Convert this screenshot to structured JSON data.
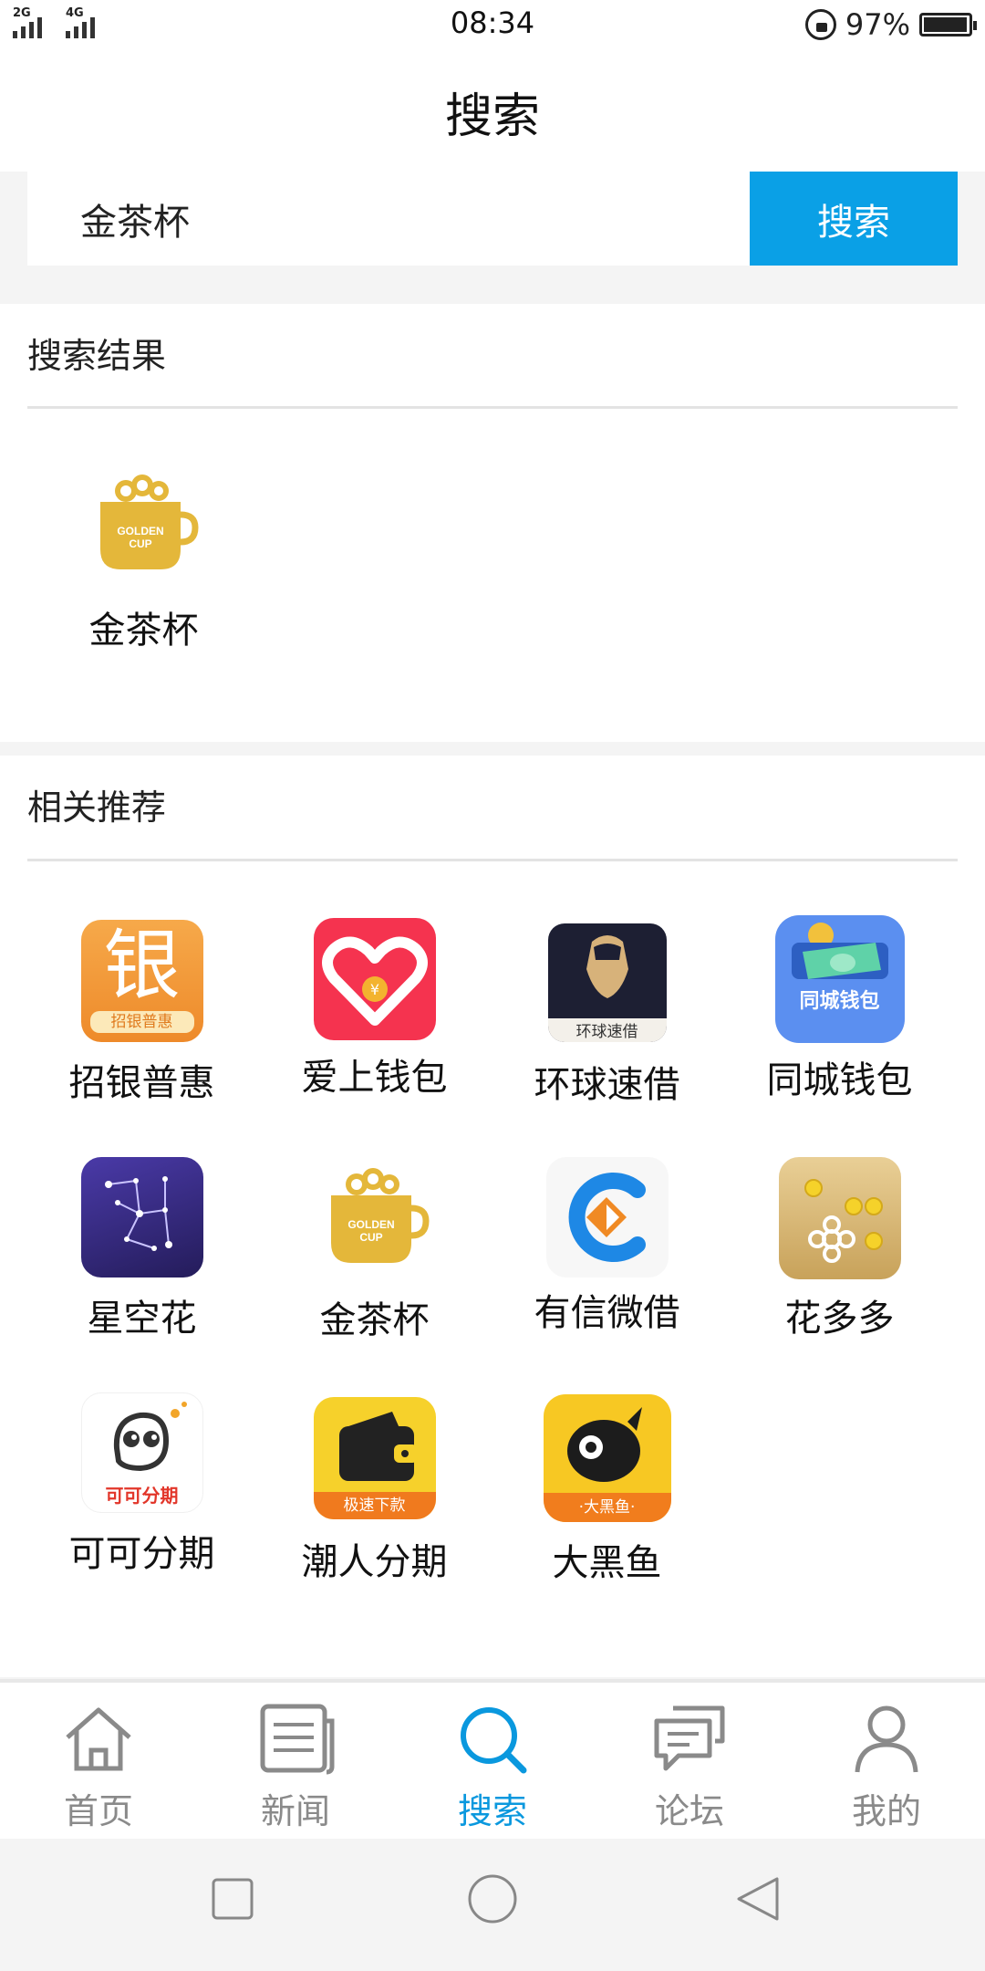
{
  "status_bar": {
    "network_left": "2G",
    "network_right": "4G",
    "time": "08:34",
    "battery": "97%",
    "battery_level": 0.97
  },
  "header": {
    "title": "搜索"
  },
  "search": {
    "value": "金茶杯",
    "button_label": "搜索"
  },
  "results": {
    "title": "搜索结果",
    "items": [
      {
        "label": "金茶杯",
        "icon": "golden-cup-icon"
      }
    ]
  },
  "recommend": {
    "title": "相关推荐",
    "items": [
      {
        "label": "招银普惠",
        "icon": "zhaoyin-puhui-icon",
        "icon_text": "银",
        "icon_sub": "招银普惠"
      },
      {
        "label": "爱上钱包",
        "icon": "heart-wallet-icon"
      },
      {
        "label": "环球速借",
        "icon": "huanqiu-sujie-icon",
        "icon_sub": "环球速借"
      },
      {
        "label": "同城钱包",
        "icon": "tongcheng-wallet-icon",
        "icon_sub": "同城钱包"
      },
      {
        "label": "星空花",
        "icon": "starry-sky-icon"
      },
      {
        "label": "金茶杯",
        "icon": "golden-cup-icon"
      },
      {
        "label": "有信微借",
        "icon": "youxin-weijie-icon"
      },
      {
        "label": "花多多",
        "icon": "huaduoduo-icon"
      },
      {
        "label": "可可分期",
        "icon": "keke-fenqi-icon",
        "icon_sub": "可可分期"
      },
      {
        "label": "潮人分期",
        "icon": "chaoren-fenqi-icon",
        "icon_sub": "极速下款"
      },
      {
        "label": "大黑鱼",
        "icon": "big-black-fish-icon",
        "icon_sub": "·大黑鱼·"
      }
    ]
  },
  "golden_cup_text": [
    "GOLDEN",
    "CUP"
  ],
  "tabbar": {
    "items": [
      {
        "label": "首页",
        "icon": "home-icon"
      },
      {
        "label": "新闻",
        "icon": "news-icon"
      },
      {
        "label": "搜索",
        "icon": "search-icon",
        "active": true
      },
      {
        "label": "论坛",
        "icon": "forum-icon"
      },
      {
        "label": "我的",
        "icon": "profile-icon"
      }
    ]
  },
  "colors": {
    "accent": "#0aa0e6",
    "tab_active": "#0a98de",
    "tab_inactive": "#8a8a8a"
  }
}
